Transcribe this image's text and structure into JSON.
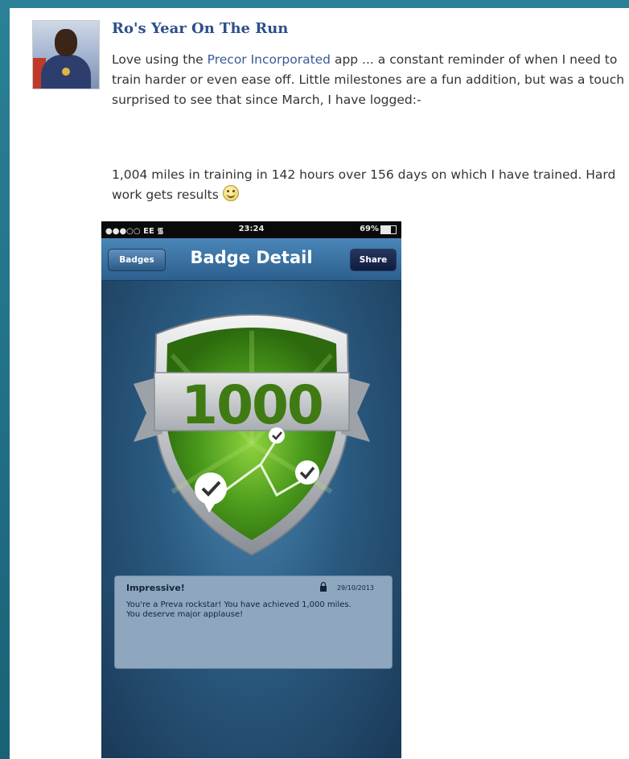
{
  "post": {
    "title": "Ro's Year On The Run",
    "paragraph1_prefix": "Love using the ",
    "link_text": "Precor Incorporated",
    "paragraph1_suffix": " app ... a constant reminder of when I need to train harder or even ease off. Little milestones are a fun addition, but was a touch surprised to see that since March, I have logged:-",
    "paragraph2": "1,004 miles in training in 142 hours over 156 days on which I have trained. Hard work gets results "
  },
  "phone": {
    "status": {
      "carrier": "●●●○○ EE",
      "time": "23:24",
      "battery": "69%"
    },
    "navbar": {
      "back_label": "Badges",
      "title": "Badge Detail",
      "share_label": "Share"
    },
    "badge": {
      "number": "1000"
    },
    "info": {
      "title": "Impressive!",
      "date": "29/10/2013",
      "message": "You're a Preva rockstar! You have achieved 1,000 miles. You deserve major applause!"
    }
  },
  "colors": {
    "frame": "#1f6f86",
    "title": "#2d4f8a",
    "link": "#3b5998",
    "badge_green": "#4a9a1c"
  },
  "icons": [
    "smiley-emoticon-icon",
    "wifi-icon",
    "battery-icon",
    "lock-icon",
    "checkmark-icon"
  ]
}
